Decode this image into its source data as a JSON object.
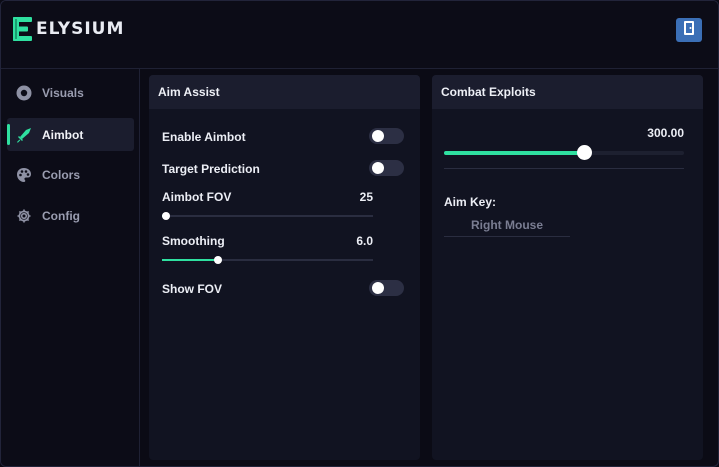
{
  "app": {
    "name": "ELYSIUM",
    "accent": "#2fe0a0"
  },
  "header": {
    "button_icon": "exit-door-icon"
  },
  "sidebar": {
    "items": [
      {
        "label": "Visuals",
        "icon": "eye-icon",
        "active": false
      },
      {
        "label": "Aimbot",
        "icon": "sword-icon",
        "active": true
      },
      {
        "label": "Colors",
        "icon": "palette-icon",
        "active": false
      },
      {
        "label": "Config",
        "icon": "gear-icon",
        "active": false
      }
    ]
  },
  "aim_assist": {
    "title": "Aim Assist",
    "enable_aimbot": {
      "label": "Enable Aimbot",
      "on": false
    },
    "target_prediction": {
      "label": "Target Prediction",
      "on": false
    },
    "aimbot_fov": {
      "label": "Aimbot FOV",
      "value": "25",
      "fraction": 0.02
    },
    "smoothing": {
      "label": "Smoothing",
      "value": "6.0",
      "fraction": 0.265
    },
    "show_fov": {
      "label": "Show FOV",
      "on": false
    }
  },
  "combat_exploits": {
    "title": "Combat Exploits",
    "slider": {
      "value": "300.00",
      "fraction": 0.585
    },
    "aim_key": {
      "label": "Aim Key:",
      "value": "Right Mouse"
    }
  }
}
